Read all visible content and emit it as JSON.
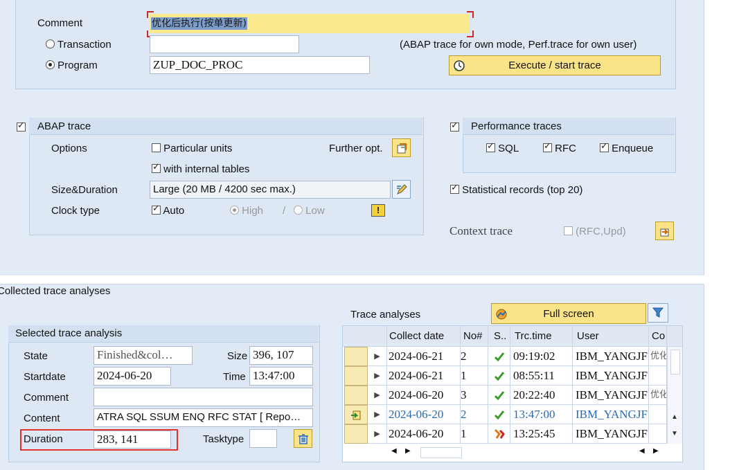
{
  "top": {
    "comment_label": "Comment",
    "comment_value": "优化后执行(按单更新)",
    "transaction_label": "Transaction",
    "transaction_value": "",
    "program_label": "Program",
    "program_value": "ZUP_DOC_PROC",
    "hint": "(ABAP trace for own mode, Perf.trace for own user)",
    "execute_label": "Execute / start trace"
  },
  "abap_trace": {
    "title": "ABAP trace",
    "options_label": "Options",
    "particular_units": "Particular units",
    "further_opt": "Further opt.",
    "with_internal_tables": "with internal tables",
    "size_label": "Size&Duration",
    "size_value": "Large (20 MB / 4200 sec max.)",
    "clock_label": "Clock type",
    "auto": "Auto",
    "high": "High",
    "slash": "/",
    "low": "Low"
  },
  "perf_traces": {
    "title": "Performance traces",
    "sql": "SQL",
    "rfc": "RFC",
    "enqueue": "Enqueue",
    "statistical": "Statistical records (top 20)",
    "context_trace": "Context trace",
    "rfc_upd": "(RFC,Upd)"
  },
  "collected": {
    "title": "Collected trace analyses",
    "selected_title": "Selected trace analysis",
    "state_label": "State",
    "state_value": "Finished&col…",
    "size_label": "Size",
    "size_value": "396, 107",
    "startdate_label": "Startdate",
    "startdate_value": "2024-06-20",
    "time_label": "Time",
    "time_value": "13:47:00",
    "comment_label": "Comment",
    "comment_value": "",
    "content_label": "Content",
    "content_value": "ATRA SQL SSUM ENQ RFC STAT [ Repo…",
    "duration_label": "Duration",
    "duration_value": "283, 141",
    "tasktype_label": "Tasktype",
    "tasktype_value": ""
  },
  "analyses": {
    "title": "Trace analyses",
    "fullscreen_label": "Full screen",
    "columns": [
      "Collect date",
      "No#",
      "S..",
      "Trc.time",
      "User",
      "Co"
    ],
    "rows": [
      {
        "date": "2024-06-21",
        "no": "2",
        "status": "check",
        "time": "09:19:02",
        "user": "IBM_YANGJF",
        "co": "优化"
      },
      {
        "date": "2024-06-21",
        "no": "1",
        "status": "check",
        "time": "08:55:11",
        "user": "IBM_YANGJF",
        "co": ""
      },
      {
        "date": "2024-06-20",
        "no": "3",
        "status": "check",
        "time": "20:22:40",
        "user": "IBM_YANGJF",
        "co": "优化"
      },
      {
        "date": "2024-06-20",
        "no": "2",
        "status": "check",
        "time": "13:47:00",
        "user": "IBM_YANGJF",
        "co": ""
      },
      {
        "date": "2024-06-20",
        "no": "1",
        "status": "warn",
        "time": "13:25:45",
        "user": "IBM_YANGJF",
        "co": ""
      }
    ]
  },
  "colors": {
    "panel": "#e2ebf6",
    "button_yellow": "#fbe487",
    "highlight_red": "#e03030",
    "selected_blue": "#2a6bb0",
    "check_green": "#3a9a2a"
  }
}
